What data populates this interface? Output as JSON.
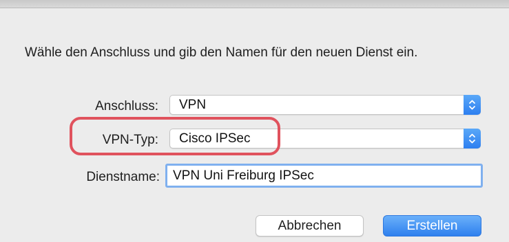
{
  "dialog": {
    "prompt": "Wähle den Anschluss und gib den Namen für den neuen Dienst ein."
  },
  "fields": {
    "interface_label": "Anschluss:",
    "interface_value": "VPN",
    "vpn_type_label": "VPN-Typ:",
    "vpn_type_value": "Cisco IPSec",
    "service_name_label": "Dienstname:",
    "service_name_value": "VPN Uni Freiburg IPSec"
  },
  "buttons": {
    "cancel_label": "Abbrechen",
    "create_label": "Erstellen"
  },
  "icons": {
    "popup_stepper": "chevron-up-down-icon"
  },
  "colors": {
    "accent": "#2f80ee",
    "highlight": "#e0525d",
    "focus_ring": "#7fb0ef"
  }
}
